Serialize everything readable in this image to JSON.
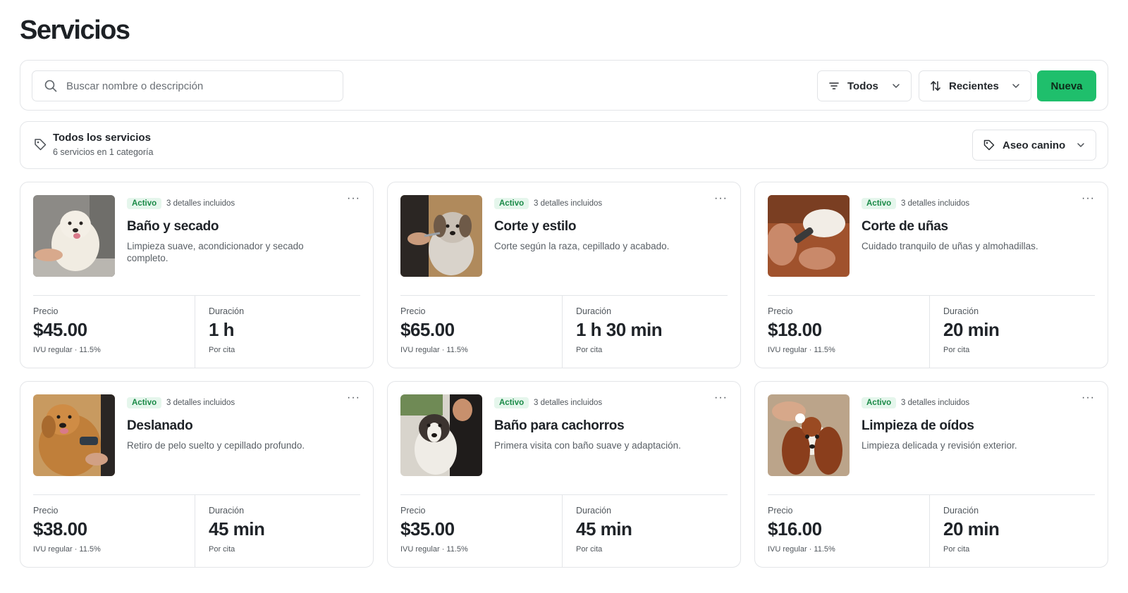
{
  "page": {
    "title": "Servicios"
  },
  "toolbar": {
    "search_placeholder": "Buscar nombre o descripción",
    "filter_label": "Todos",
    "sort_label": "Recientes",
    "new_label": "Nueva"
  },
  "category": {
    "title": "Todos los servicios",
    "subtitle": "6 servicios en 1 categoría",
    "select_label": "Aseo canino"
  },
  "labels": {
    "price": "Precio",
    "duration": "Duración",
    "tax": "IVU regular · 11.5%",
    "per": "Por cita",
    "more": "···"
  },
  "colors": {
    "accent": "#1fbf6c",
    "badge_bg": "#e5f6ec",
    "badge_text": "#1a8a47"
  },
  "services": [
    {
      "status": "Activo",
      "details": "3 detalles incluidos",
      "name": "Baño y secado",
      "description": "Limpieza suave, acondicionador y secado completo.",
      "price": "$45.00",
      "duration": "1 h",
      "image": "white-fluffy-dog-bath"
    },
    {
      "status": "Activo",
      "details": "3 detalles incluidos",
      "name": "Corte y estilo",
      "description": "Corte según la raza, cepillado y acabado.",
      "price": "$65.00",
      "duration": "1 h 30 min",
      "image": "dog-haircut-scissors"
    },
    {
      "status": "Activo",
      "details": "3 detalles incluidos",
      "name": "Corte de uñas",
      "description": "Cuidado tranquilo de uñas y almohadillas.",
      "price": "$18.00",
      "duration": "20 min",
      "image": "dog-paw-nail-clipper"
    },
    {
      "status": "Activo",
      "details": "3 detalles incluidos",
      "name": "Deslanado",
      "description": "Retiro de pelo suelto y cepillado profundo.",
      "price": "$38.00",
      "duration": "45 min",
      "image": "golden-retriever-brush"
    },
    {
      "status": "Activo",
      "details": "3 detalles incluidos",
      "name": "Baño para cachorros",
      "description": "Primera visita con baño suave y adaptación.",
      "price": "$35.00",
      "duration": "45 min",
      "image": "puppy-with-groomer"
    },
    {
      "status": "Activo",
      "details": "3 detalles incluidos",
      "name": "Limpieza de oídos",
      "description": "Limpieza delicada y revisión exterior.",
      "price": "$16.00",
      "duration": "20 min",
      "image": "spaniel-ear-cleaning"
    }
  ]
}
